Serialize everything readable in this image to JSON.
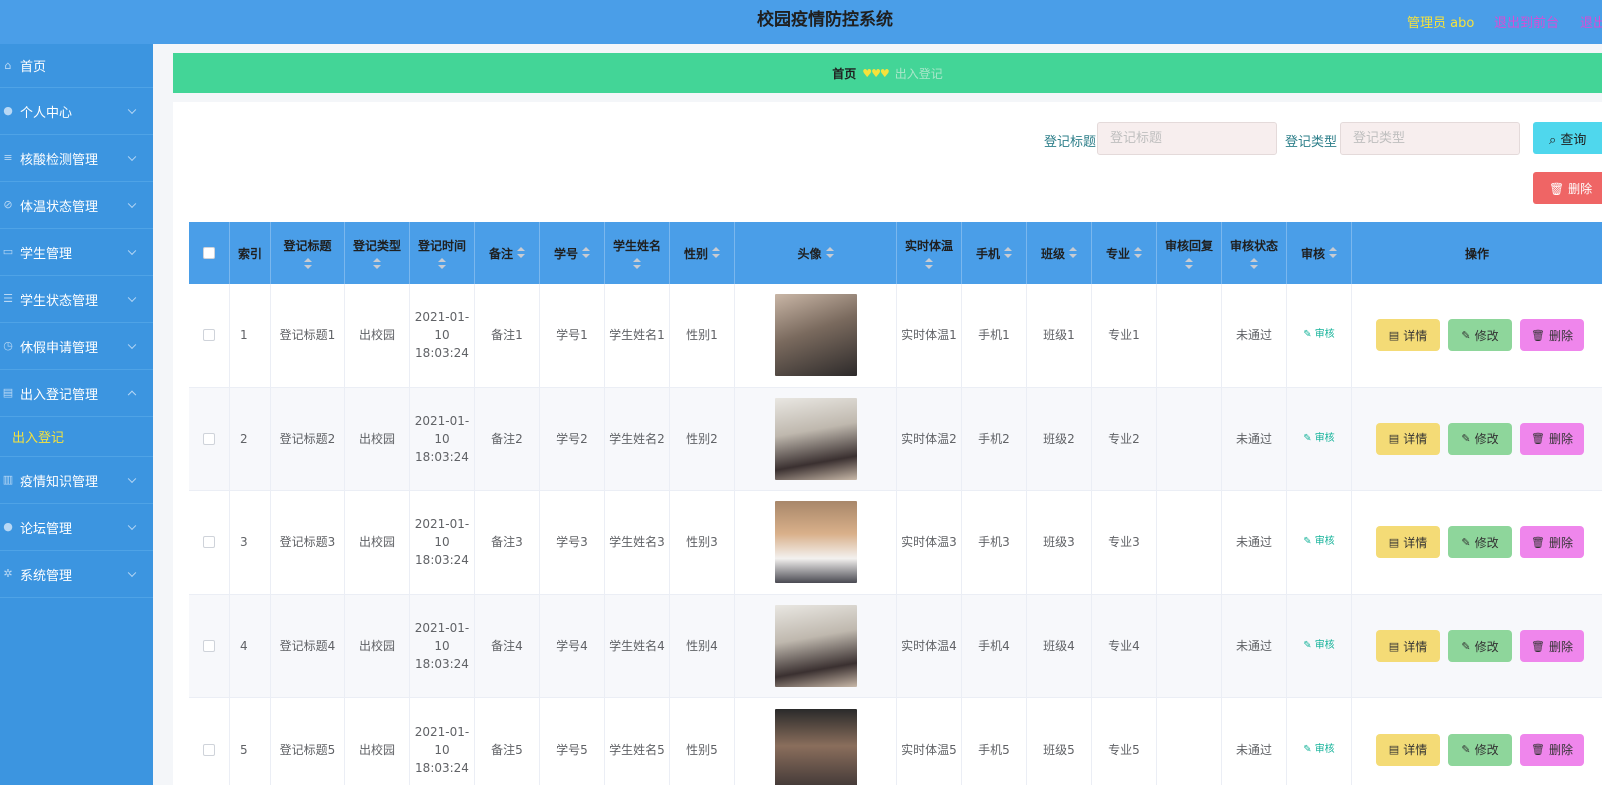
{
  "header": {
    "title": "校园疫情防控系统",
    "admin_label": "管理员 abo",
    "exit_front": "退出到前台",
    "exit": "退出登录"
  },
  "sidebar": {
    "items": [
      {
        "label": "首页",
        "icon": "home-icon"
      },
      {
        "label": "个人中心",
        "icon": "user-icon"
      },
      {
        "label": "核酸检测管理",
        "icon": "sliders-icon"
      },
      {
        "label": "体温状态管理",
        "icon": "block-icon"
      },
      {
        "label": "学生管理",
        "icon": "monitor-icon"
      },
      {
        "label": "学生状态管理",
        "icon": "list-icon"
      },
      {
        "label": "休假申请管理",
        "icon": "clock-icon"
      },
      {
        "label": "出入登记管理",
        "icon": "news-icon"
      },
      {
        "label": "疫情知识管理",
        "icon": "chart-icon"
      },
      {
        "label": "论坛管理",
        "icon": "user-icon"
      },
      {
        "label": "系统管理",
        "icon": "setting-icon"
      }
    ],
    "submenu": {
      "label": "出入登记"
    }
  },
  "breadcrumb": {
    "home": "首页",
    "separator": "♥♥♥",
    "current": "出入登记"
  },
  "search": {
    "title_label": "登记标题",
    "title_placeholder": "登记标题",
    "type_label": "登记类型",
    "type_placeholder": "登记类型",
    "search_button": "查询",
    "delete_button": "删除"
  },
  "table": {
    "headers": {
      "index": "索引",
      "title": "登记标题",
      "type": "登记类型",
      "time": "登记时间",
      "note": "备注",
      "student_no": "学号",
      "student_name": "学生姓名",
      "gender": "性别",
      "avatar": "头像",
      "temperature": "实时体温",
      "phone": "手机",
      "class": "班级",
      "major": "专业",
      "audit_reply": "审核回复",
      "audit_status": "审核状态",
      "audit": "审核",
      "actions": "操作"
    },
    "audit_link": "审核",
    "buttons": {
      "detail": "详情",
      "edit": "修改",
      "delete": "删除"
    },
    "rows": [
      {
        "index": "1",
        "title": "登记标题1",
        "type": "出校园",
        "time": "2021-01-10 18:03:24",
        "note": "备注1",
        "student_no": "学号1",
        "student_name": "学生姓名1",
        "gender": "性别1",
        "temperature": "实时体温1",
        "phone": "手机1",
        "class": "班级1",
        "major": "专业1",
        "audit_reply": "",
        "audit_status": "未通过"
      },
      {
        "index": "2",
        "title": "登记标题2",
        "type": "出校园",
        "time": "2021-01-10 18:03:24",
        "note": "备注2",
        "student_no": "学号2",
        "student_name": "学生姓名2",
        "gender": "性别2",
        "temperature": "实时体温2",
        "phone": "手机2",
        "class": "班级2",
        "major": "专业2",
        "audit_reply": "",
        "audit_status": "未通过"
      },
      {
        "index": "3",
        "title": "登记标题3",
        "type": "出校园",
        "time": "2021-01-10 18:03:24",
        "note": "备注3",
        "student_no": "学号3",
        "student_name": "学生姓名3",
        "gender": "性别3",
        "temperature": "实时体温3",
        "phone": "手机3",
        "class": "班级3",
        "major": "专业3",
        "audit_reply": "",
        "audit_status": "未通过"
      },
      {
        "index": "4",
        "title": "登记标题4",
        "type": "出校园",
        "time": "2021-01-10 18:03:24",
        "note": "备注4",
        "student_no": "学号4",
        "student_name": "学生姓名4",
        "gender": "性别4",
        "temperature": "实时体温4",
        "phone": "手机4",
        "class": "班级4",
        "major": "专业4",
        "audit_reply": "",
        "audit_status": "未通过"
      },
      {
        "index": "5",
        "title": "登记标题5",
        "type": "出校园",
        "time": "2021-01-10 18:03:24",
        "note": "备注5",
        "student_no": "学号5",
        "student_name": "学生姓名5",
        "gender": "性别5",
        "temperature": "实时体温5",
        "phone": "手机5",
        "class": "班级5",
        "major": "专业5",
        "audit_reply": "",
        "audit_status": "未通过"
      }
    ]
  },
  "colors": {
    "topbar": "#4a9ee8",
    "sidebar": "#3c95e0",
    "breadcrumb_bg": "#43d597",
    "accent_yellow": "#f6e23c"
  }
}
